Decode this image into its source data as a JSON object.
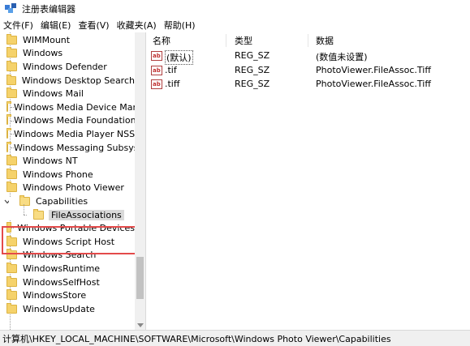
{
  "window": {
    "title": "注册表编辑器"
  },
  "menu": [
    {
      "label": "文件(F)"
    },
    {
      "label": "编辑(E)"
    },
    {
      "label": "查看(V)"
    },
    {
      "label": "收藏夹(A)"
    },
    {
      "label": "帮助(H)"
    }
  ],
  "tree": {
    "items": [
      {
        "label": "WIMMount"
      },
      {
        "label": "Windows"
      },
      {
        "label": "Windows Defender"
      },
      {
        "label": "Windows Desktop Search"
      },
      {
        "label": "Windows Mail"
      },
      {
        "label": "Windows Media Device Mana"
      },
      {
        "label": "Windows Media Foundation"
      },
      {
        "label": "Windows Media Player NSS"
      },
      {
        "label": "Windows Messaging Subsyst"
      },
      {
        "label": "Windows NT"
      },
      {
        "label": "Windows Phone"
      },
      {
        "label": "Windows Photo Viewer"
      },
      {
        "label": "Capabilities",
        "expanded": true
      },
      {
        "label": "FileAssociations",
        "selected": true
      },
      {
        "label": "Windows Portable Devices"
      },
      {
        "label": "Windows Script Host"
      },
      {
        "label": "Windows Search"
      },
      {
        "label": "WindowsRuntime"
      },
      {
        "label": "WindowsSelfHost"
      },
      {
        "label": "WindowsStore"
      },
      {
        "label": "WindowsUpdate"
      }
    ]
  },
  "columns": {
    "name": "名称",
    "type": "类型",
    "data": "数据"
  },
  "values": [
    {
      "icon": "ab",
      "name": "(默认)",
      "type": "REG_SZ",
      "data": "(数值未设置)"
    },
    {
      "icon": "ab",
      "name": ".tif",
      "type": "REG_SZ",
      "data": "PhotoViewer.FileAssoc.Tiff"
    },
    {
      "icon": "ab",
      "name": ".tiff",
      "type": "REG_SZ",
      "data": "PhotoViewer.FileAssoc.Tiff"
    }
  ],
  "icons": {
    "value_icon_text": "ab"
  },
  "status": {
    "path": "计算机\\HKEY_LOCAL_MACHINE\\SOFTWARE\\Microsoft\\Windows Photo Viewer\\Capabilities"
  },
  "colors": {
    "highlight_box": "#e44a4a",
    "selected_bg": "#d9d9d9",
    "folder": "#f5d26b"
  }
}
